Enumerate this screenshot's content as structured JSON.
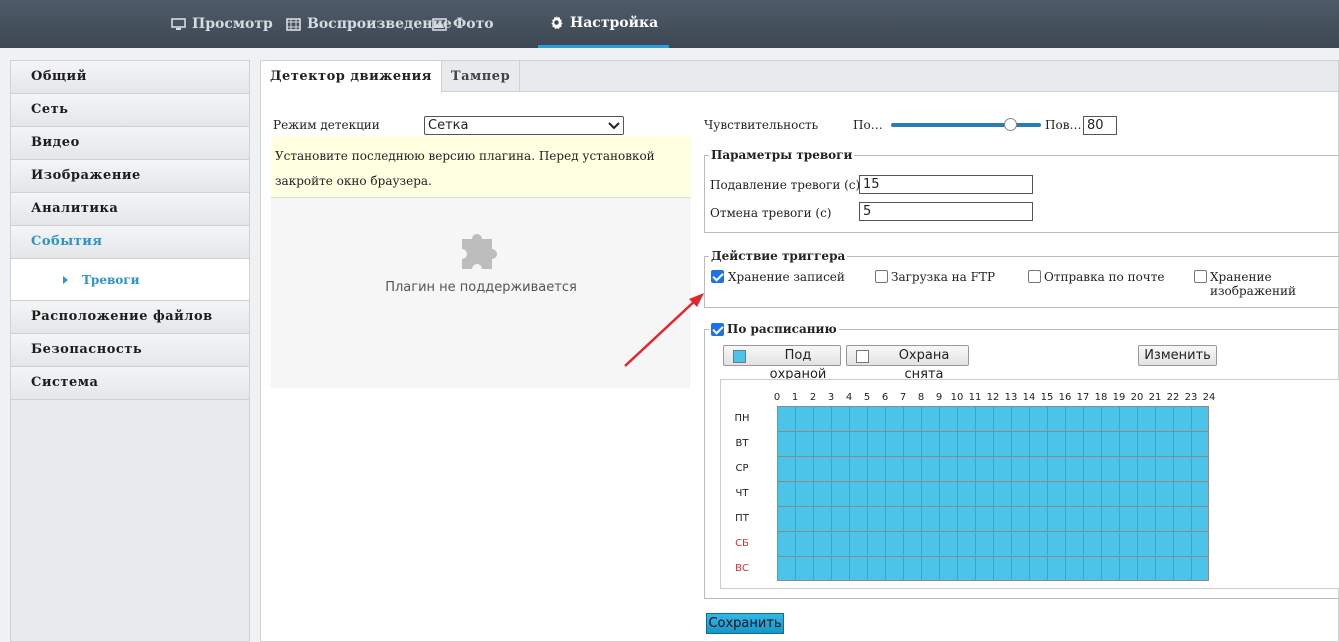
{
  "top_nav": {
    "items": [
      {
        "label": "Просмотр",
        "icon": "monitor-icon"
      },
      {
        "label": "Воспроизведение",
        "icon": "film-icon"
      },
      {
        "label": "Фото",
        "icon": "image-icon"
      },
      {
        "label": "Настройка",
        "icon": "gear-icon",
        "active": true
      }
    ]
  },
  "sidebar": {
    "items": [
      "Общий",
      "Сеть",
      "Видео",
      "Изображение",
      "Аналитика",
      "События",
      "Расположение файлов",
      "Безопасность",
      "Система"
    ],
    "active": "События",
    "sub_item": "Тревоги"
  },
  "tabs": [
    "Детектор движения",
    "Тампер"
  ],
  "detection": {
    "mode_label": "Режим детекции",
    "mode_value": "Сетка",
    "notice": "Установите последнюю версию плагина. Перед установкой закройте окно браузера.",
    "plugin_message": "Плагин не поддерживается"
  },
  "sensitivity": {
    "label": "Чувствительность",
    "min_label": "По…",
    "max_label": "Пов…",
    "value": "80",
    "level": 80
  },
  "alarm_params": {
    "title": "Параметры тревоги",
    "suppress_label": "Подавление тревоги (с)",
    "suppress_value": "15",
    "cancel_label": "Отмена тревоги (с)",
    "cancel_value": "5"
  },
  "trigger_action": {
    "title": "Действие триггера",
    "options": [
      {
        "label": "Хранение записей",
        "checked": true
      },
      {
        "label": "Загрузка на FTP",
        "checked": false
      },
      {
        "label": "Отправка по почте",
        "checked": false
      },
      {
        "label": "Хранение изображений",
        "checked": false
      }
    ]
  },
  "schedule": {
    "title": "По расписанию",
    "checked": true,
    "armed_label": "Под охраной",
    "disarmed_label": "Охрана снята",
    "edit_label": "Изменить",
    "armed_color": "#4cc3e9",
    "hours": [
      "0",
      "1",
      "2",
      "3",
      "4",
      "5",
      "6",
      "7",
      "8",
      "9",
      "10",
      "11",
      "12",
      "13",
      "14",
      "15",
      "16",
      "17",
      "18",
      "19",
      "20",
      "21",
      "22",
      "23",
      "24"
    ],
    "days": [
      "ПН",
      "ВТ",
      "СР",
      "ЧТ",
      "ПТ",
      "СБ",
      "ВС"
    ]
  },
  "save_label": "Сохранить"
}
